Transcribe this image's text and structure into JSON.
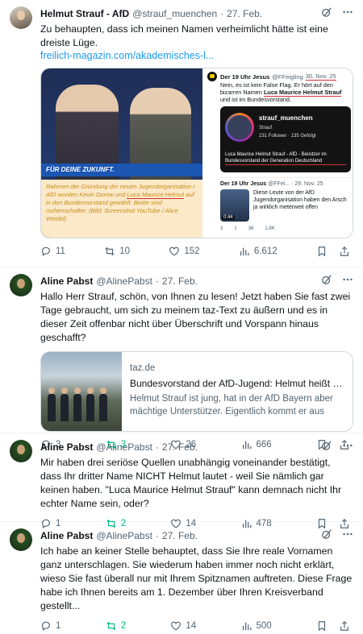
{
  "tweets": [
    {
      "name": "Helmut Strauf - AfD",
      "handle": "@strauf_muenchen",
      "date": "27. Feb.",
      "text": "Zu behaupten, dass ich meinen Namen verheimlicht hätte ist eine dreiste Lüge.",
      "link": "freilich-magazin.com/akademisches-l...",
      "media": {
        "banner": "FÜR DEINE ZUKUNFT.",
        "caption_pre": "Rahmen der Gründung der neuen Jugendorganisation r AfD wurden Kevin Dorow und ",
        "caption_name": "Luca Maurice Helmut",
        "caption_post": " auf in den Bundesvorstand gewählt. Beide sind rschenschafter. (Bild: Screenshot YouTube / Alice Weidel)",
        "quote_name": "Der 19 Uhr Jesus",
        "quote_handle": "@FFeigling",
        "quote_date": "30. Nov. 25",
        "quote_text_pre": "Nein, es ist kein False Flag. Er hört auf den bizarren Namen ",
        "quote_text_name": "Luca Maurice Helmut Strauf",
        "quote_text_post": " und ist im Bundesvorstand.",
        "ig_username": "strauf_muenchen",
        "ig_sub": "Strauf",
        "ig_stats": "231 Follower · 135 Gefolgt",
        "ig_bio": "Luca Maurice Helmut Strauf - AfD - Beisitzer im Bundesvorstand der Generation Deutschland",
        "quote2_name": "Der 19 Uhr Jesus",
        "quote2_handle": "@FFei...",
        "quote2_date": "· 29. Nov. 25",
        "quote2_text": "Diese Leute von der AfD Jugendorganisation haben den Arsch ja wirklich meterweit offen",
        "quote2_time": "0:44",
        "qa_reply": "3",
        "qa_rt": "1",
        "qa_like": "36",
        "qa_views": "1,8K"
      },
      "replies": "11",
      "reposts": "10",
      "likes": "152",
      "views": "6.612"
    },
    {
      "name": "Aline Pabst",
      "handle": "@AlinePabst",
      "date": "27. Feb.",
      "text": "Hallo Herr Strauf, schön, von Ihnen zu lesen! Jetzt haben Sie fast zwei Tage gebraucht, um sich zu meinem taz-Text zu äußern und es in dieser Zeit offenbar nicht über Überschrift und Vorspann hinaus geschafft?",
      "card": {
        "domain": "taz.de",
        "title": "Bundesvorstand der AfD-Jugend: Helmut heißt nic...",
        "desc": "Helmut Strauf ist jung, hat in der AfD Bayern aber mächtige Unterstützer. Eigentlich kommt er aus de..."
      },
      "replies": "3",
      "reposts": "3",
      "likes": "26",
      "views": "666"
    },
    {
      "name": "Aline Pabst",
      "handle": "@AlinePabst",
      "date": "27. Feb.",
      "text": "Mir haben drei seriöse Quellen unabhängig voneinander bestätigt, dass Ihr dritter Name NICHT Helmut lautet - weil Sie nämlich gar keinen haben. \"Luca Maurice Helmut Strauf\" kann demnach nicht Ihr echter Name sein, oder?",
      "replies": "1",
      "reposts": "2",
      "likes": "14",
      "views": "478"
    },
    {
      "name": "Aline Pabst",
      "handle": "@AlinePabst",
      "date": "27. Feb.",
      "text": "Ich habe an keiner Stelle behauptet, dass Sie Ihre reale Vornamen ganz unterschlagen. Sie wiederum haben immer noch nicht erklärt, wieso Sie fast überall nur mit Ihrem Spitznamen auftreten. Diese Frage habe ich Ihnen bereits am 1. Dezember über Ihren Kreisverband gestellt...",
      "replies": "1",
      "reposts": "2",
      "likes": "14",
      "views": "500"
    }
  ],
  "dot": "·",
  "colors": {
    "link": "#1d9bf0",
    "repost_active": "#00ba7c",
    "muted": "#536471"
  }
}
